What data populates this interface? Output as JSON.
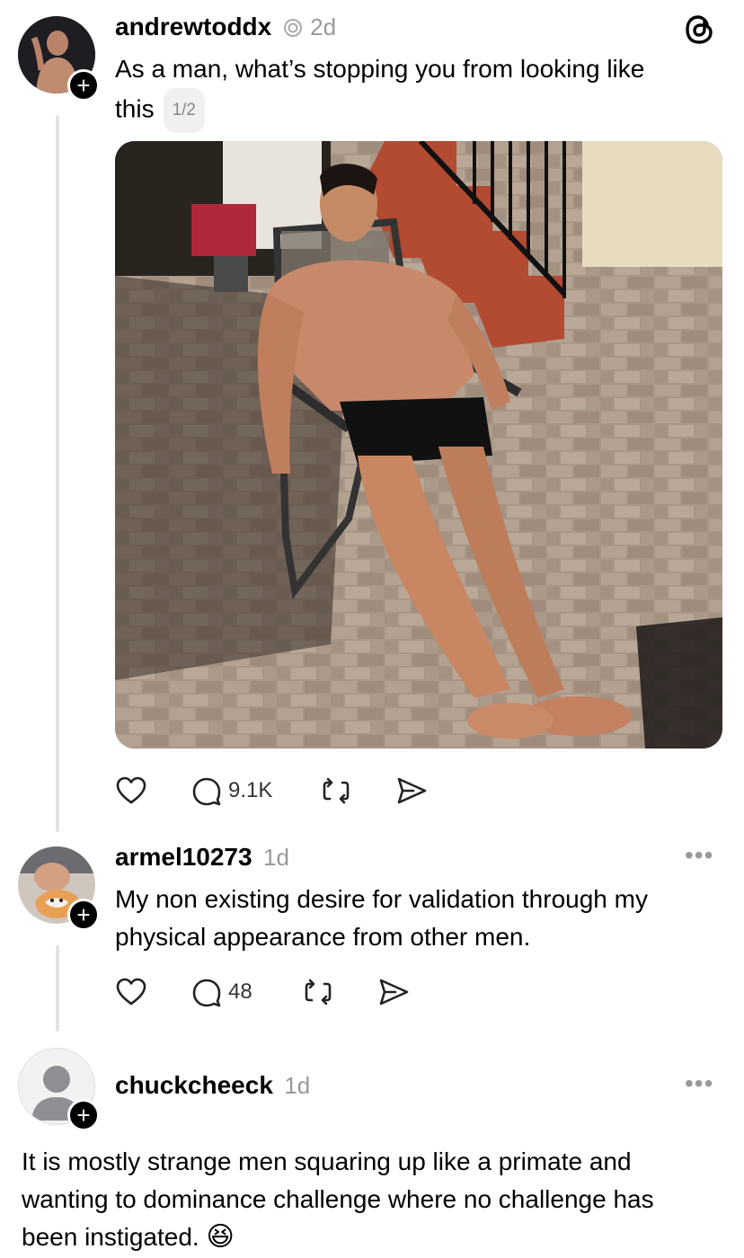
{
  "post": {
    "username": "andrewtoddx",
    "time": "2d",
    "text_line1": "As a man, what’s stopping you from looking like",
    "text_line2": "this",
    "pager": "1/2",
    "replies_count": "9.1K"
  },
  "reply1": {
    "username": "armel10273",
    "time": "1d",
    "text_line1": "My non existing desire for validation through my",
    "text_line2": "physical appearance from other men.",
    "replies_count": "48"
  },
  "reply2": {
    "username": "chuckcheeck",
    "time": "1d",
    "text_line1": "It is mostly strange men squaring up like a primate and",
    "text_line2": "wanting to dominance challenge where no challenge has",
    "text_line3": "been instigated.",
    "emoji": "😆"
  },
  "icons": {
    "threads_logo": "threads-logo-icon",
    "heart": "heart-icon",
    "comment": "comment-icon",
    "repost": "repost-icon",
    "share": "share-icon",
    "more": "more-icon"
  }
}
